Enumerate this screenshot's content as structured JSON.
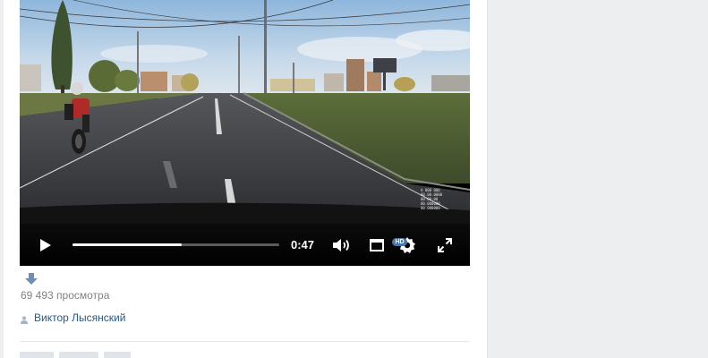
{
  "player": {
    "time": "0:47",
    "progress": 0.53,
    "hd_badge": "HD",
    "controls": [
      "play-icon",
      "volume-icon",
      "fullscreen-window-icon",
      "settings-gear-icon",
      "expand-icon"
    ]
  },
  "video_overlay": {
    "hud_lines": [
      "А 000 000",
      "00.00.0000",
      "00:00:00",
      "00.000000",
      "00.000000"
    ]
  },
  "meta": {
    "views": "69 493 просмотра",
    "author": "Виктор Лысянский"
  },
  "colors": {
    "accent": "#4a76a8",
    "link": "#2a5885",
    "muted": "#828282",
    "page_bg": "#edeef0"
  }
}
